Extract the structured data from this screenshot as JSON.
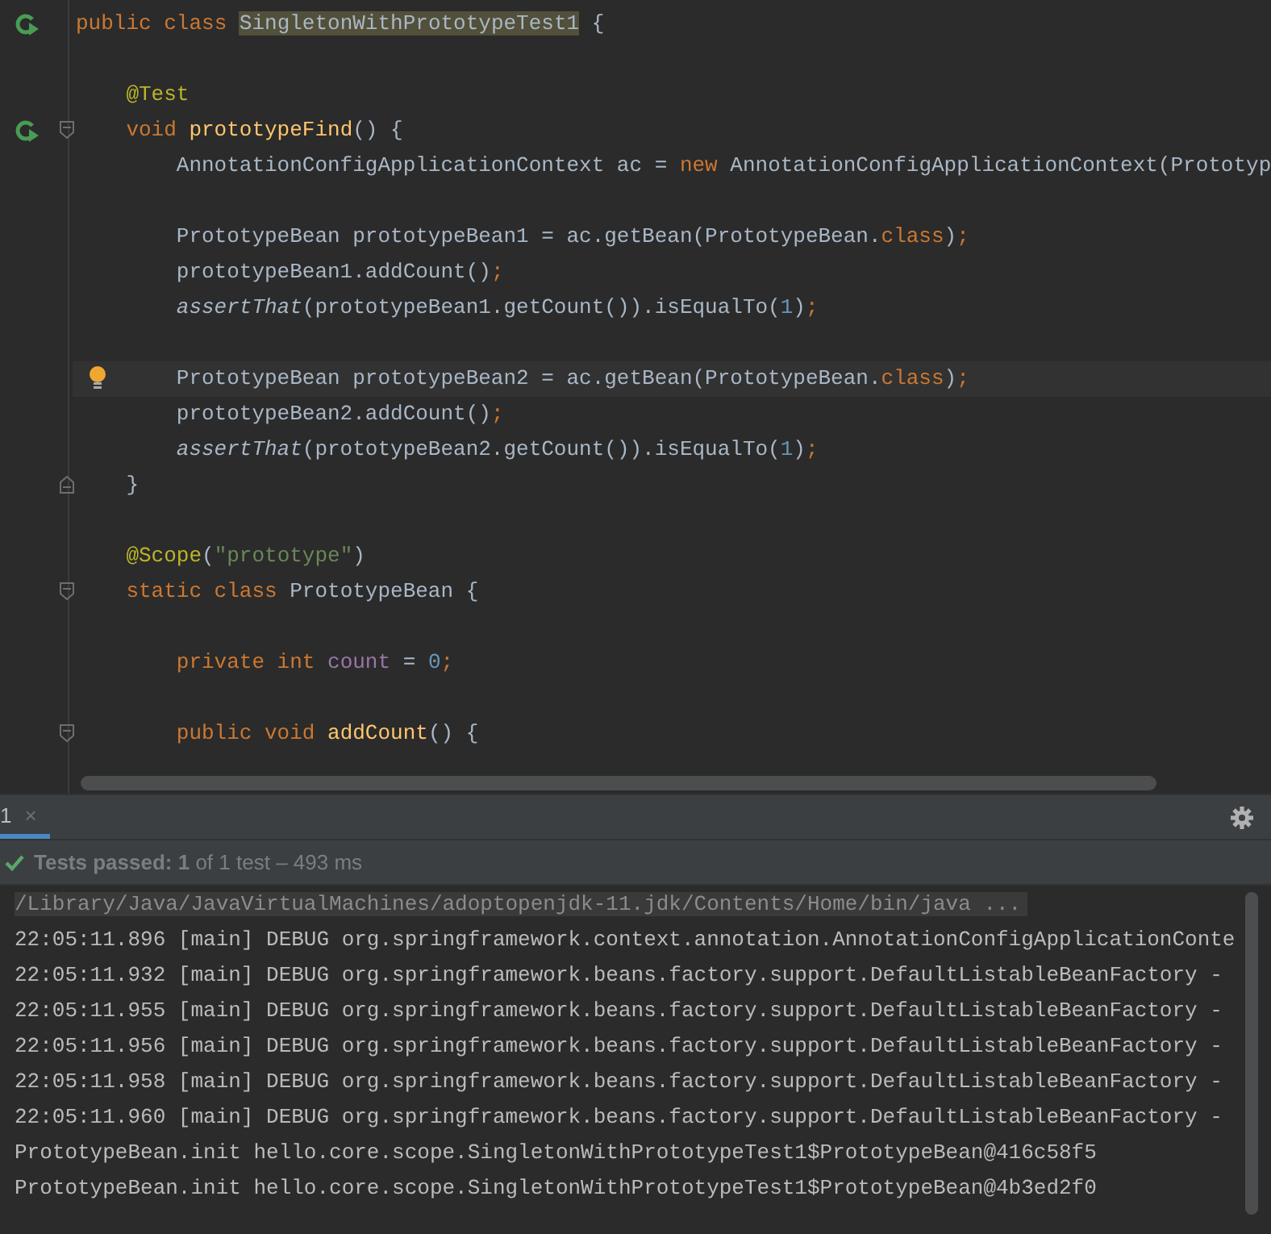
{
  "editor": {
    "code": [
      {
        "run_icon": true,
        "tokens": [
          {
            "kind": "kw",
            "text": "public class "
          },
          {
            "kind": "hl",
            "text": "SingletonWithPrototypeTest1"
          },
          {
            "kind": "plain",
            "text": " {"
          }
        ],
        "children": [
          {
            "gap_before": true,
            "tokens": [
              {
                "kind": "ann",
                "text": "@Test"
              }
            ]
          },
          {
            "run_icon": true,
            "fold_open": true,
            "tokens": [
              {
                "kind": "kw",
                "text": "void "
              },
              {
                "kind": "fn",
                "text": "prototypeFind"
              },
              {
                "kind": "plain",
                "text": "() {"
              }
            ],
            "children": [
              {
                "tokens": [
                  {
                    "kind": "plain",
                    "text": "AnnotationConfigApplicationContext ac = "
                  },
                  {
                    "kind": "kw",
                    "text": "new "
                  },
                  {
                    "kind": "plain",
                    "text": "AnnotationConfigApplicationContext(Prototyp"
                  }
                ]
              },
              {
                "gap_before": true,
                "tokens": [
                  {
                    "kind": "plain",
                    "text": "PrototypeBean prototypeBean1 = ac.getBean(PrototypeBean."
                  },
                  {
                    "kind": "kw",
                    "text": "class"
                  },
                  {
                    "kind": "plain",
                    "text": ")"
                  },
                  {
                    "kind": "kw",
                    "text": ";"
                  }
                ]
              },
              {
                "tokens": [
                  {
                    "kind": "plain",
                    "text": "prototypeBean1.addCount()"
                  },
                  {
                    "kind": "kw",
                    "text": ";"
                  }
                ]
              },
              {
                "tokens": [
                  {
                    "kind": "it",
                    "text": "assertThat"
                  },
                  {
                    "kind": "plain",
                    "text": "(prototypeBean1.getCount()).isEqualTo("
                  },
                  {
                    "kind": "num",
                    "text": "1"
                  },
                  {
                    "kind": "plain",
                    "text": ")"
                  },
                  {
                    "kind": "kw",
                    "text": ";"
                  }
                ]
              },
              {
                "gap_before": true,
                "bulb": true,
                "current": true,
                "tokens": [
                  {
                    "kind": "plain",
                    "text": "PrototypeBean prototypeBean2 = ac.getBean(PrototypeBean."
                  },
                  {
                    "kind": "kw",
                    "text": "class"
                  },
                  {
                    "kind": "plain",
                    "text": ")"
                  },
                  {
                    "kind": "kw",
                    "text": ";"
                  }
                ]
              },
              {
                "tokens": [
                  {
                    "kind": "plain",
                    "text": "prototypeBean2.addCount()"
                  },
                  {
                    "kind": "kw",
                    "text": ";"
                  }
                ]
              },
              {
                "tokens": [
                  {
                    "kind": "it",
                    "text": "assertThat"
                  },
                  {
                    "kind": "plain",
                    "text": "(prototypeBean2.getCount()).isEqualTo("
                  },
                  {
                    "kind": "num",
                    "text": "1"
                  },
                  {
                    "kind": "plain",
                    "text": ")"
                  },
                  {
                    "kind": "kw",
                    "text": ";"
                  }
                ]
              }
            ]
          },
          {
            "fold_close": true,
            "tokens": [
              {
                "kind": "plain",
                "text": "}"
              }
            ]
          },
          {
            "gap_before": true,
            "tokens": [
              {
                "kind": "ann",
                "text": "@Scope"
              },
              {
                "kind": "plain",
                "text": "("
              },
              {
                "kind": "str",
                "text": "\"prototype\""
              },
              {
                "kind": "plain",
                "text": ")"
              }
            ]
          },
          {
            "fold_open": true,
            "tokens": [
              {
                "kind": "kw",
                "text": "static class "
              },
              {
                "kind": "plain",
                "text": "PrototypeBean {"
              }
            ],
            "children": [
              {
                "gap_before": true,
                "tokens": [
                  {
                    "kind": "kw",
                    "text": "private int "
                  },
                  {
                    "kind": "field",
                    "text": "count"
                  },
                  {
                    "kind": "plain",
                    "text": " = "
                  },
                  {
                    "kind": "num",
                    "text": "0"
                  },
                  {
                    "kind": "kw",
                    "text": ";"
                  }
                ]
              },
              {
                "gap_before": true,
                "fold_open": true,
                "tokens": [
                  {
                    "kind": "kw",
                    "text": "public void "
                  },
                  {
                    "kind": "fn",
                    "text": "addCount"
                  },
                  {
                    "kind": "plain",
                    "text": "() {"
                  }
                ]
              }
            ]
          }
        ]
      }
    ]
  },
  "run_panel": {
    "tabs": [
      {
        "label": "1",
        "close": "×",
        "selected": true
      }
    ],
    "status": "**Tests passed: 1** of 1 test – 493 ms",
    "console": [
      {
        "kind": "command",
        "text": "/Library/Java/JavaVirtualMachines/adoptopenjdk-11.jdk/Contents/Home/bin/java ..."
      },
      {
        "kind": "log",
        "text": "22:05:11.896 [main] DEBUG org.springframework.context.annotation.AnnotationConfigApplicationConte"
      },
      {
        "kind": "log",
        "text": "22:05:11.932 [main] DEBUG org.springframework.beans.factory.support.DefaultListableBeanFactory -"
      },
      {
        "kind": "log",
        "text": "22:05:11.955 [main] DEBUG org.springframework.beans.factory.support.DefaultListableBeanFactory -"
      },
      {
        "kind": "log",
        "text": "22:05:11.956 [main] DEBUG org.springframework.beans.factory.support.DefaultListableBeanFactory -"
      },
      {
        "kind": "log",
        "text": "22:05:11.958 [main] DEBUG org.springframework.beans.factory.support.DefaultListableBeanFactory -"
      },
      {
        "kind": "log",
        "text": "22:05:11.960 [main] DEBUG org.springframework.beans.factory.support.DefaultListableBeanFactory -"
      },
      {
        "kind": "log",
        "text": "PrototypeBean.init hello.core.scope.SingletonWithPrototypeTest1$PrototypeBean@416c58f5"
      },
      {
        "kind": "log",
        "text": "PrototypeBean.init hello.core.scope.SingletonWithPrototypeTest1$PrototypeBean@4b3ed2f0"
      }
    ]
  }
}
